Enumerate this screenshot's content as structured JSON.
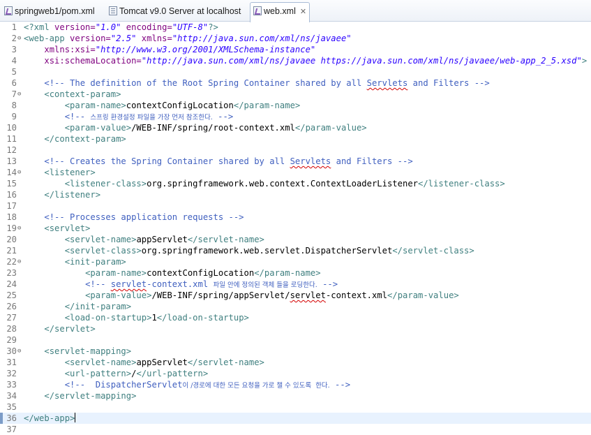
{
  "tabs": [
    {
      "label": "springweb1/pom.xml",
      "icon": "xml-file-icon",
      "active": false
    },
    {
      "label": "Tomcat v9.0 Server at localhost",
      "icon": "page-icon",
      "active": false
    },
    {
      "label": "web.xml",
      "icon": "xml-file-icon",
      "active": true,
      "close": "✕"
    }
  ],
  "editor": {
    "current_line": 36,
    "lines": [
      {
        "n": "1",
        "fold": false,
        "indent": 0,
        "parts": [
          [
            "pi",
            "<?xml "
          ],
          [
            "attr",
            "version="
          ],
          [
            "val",
            "\"1.0\""
          ],
          [
            "pi",
            " "
          ],
          [
            "attr",
            "encoding="
          ],
          [
            "val",
            "\"UTF-8\""
          ],
          [
            "pi",
            "?>"
          ]
        ]
      },
      {
        "n": "2",
        "fold": true,
        "indent": 0,
        "parts": [
          [
            "tag",
            "<web-app "
          ],
          [
            "attr",
            "version="
          ],
          [
            "val",
            "\"2.5\""
          ],
          [
            "tag",
            " "
          ],
          [
            "attr",
            "xmlns="
          ],
          [
            "val",
            "\"http://java.sun.com/xml/ns/javaee\""
          ]
        ]
      },
      {
        "n": "3",
        "fold": false,
        "indent": 4,
        "parts": [
          [
            "attr",
            "xmlns:xsi="
          ],
          [
            "val",
            "\"http://www.w3.org/2001/XMLSchema-instance\""
          ]
        ]
      },
      {
        "n": "4",
        "fold": false,
        "indent": 4,
        "parts": [
          [
            "attr",
            "xsi:schemaLocation="
          ],
          [
            "val",
            "\"http://java.sun.com/xml/ns/javaee https://java.sun.com/xml/ns/javaee/web-app_2_5.xsd\""
          ],
          [
            "tag",
            ">"
          ]
        ]
      },
      {
        "n": "5",
        "fold": false,
        "indent": 0,
        "parts": []
      },
      {
        "n": "6",
        "fold": false,
        "indent": 4,
        "parts": [
          [
            "com",
            "<!-- The definition of the Root Spring Container shared by all "
          ],
          [
            "comsq",
            "Servlets"
          ],
          [
            "com",
            " and Filters -->"
          ]
        ]
      },
      {
        "n": "7",
        "fold": true,
        "indent": 4,
        "parts": [
          [
            "tag",
            "<context-param>"
          ]
        ]
      },
      {
        "n": "8",
        "fold": false,
        "indent": 8,
        "parts": [
          [
            "tag",
            "<param-name>"
          ],
          [
            "text",
            "contextConfigLocation"
          ],
          [
            "tag",
            "</param-name>"
          ]
        ]
      },
      {
        "n": "9",
        "fold": false,
        "indent": 8,
        "parts": [
          [
            "com",
            "<!-- "
          ],
          [
            "comko",
            "스프링 환경설정 파일을 가장 먼저 참조한다."
          ],
          [
            "com",
            " -->"
          ]
        ]
      },
      {
        "n": "10",
        "fold": false,
        "indent": 8,
        "parts": [
          [
            "tag",
            "<param-value>"
          ],
          [
            "text",
            "/WEB-INF/spring/root-context.xml"
          ],
          [
            "tag",
            "</param-value>"
          ]
        ]
      },
      {
        "n": "11",
        "fold": false,
        "indent": 4,
        "parts": [
          [
            "tag",
            "</context-param>"
          ]
        ]
      },
      {
        "n": "12",
        "fold": false,
        "indent": 0,
        "parts": []
      },
      {
        "n": "13",
        "fold": false,
        "indent": 4,
        "parts": [
          [
            "com",
            "<!-- Creates the Spring Container shared by all "
          ],
          [
            "comsq",
            "Servlets"
          ],
          [
            "com",
            " and Filters -->"
          ]
        ]
      },
      {
        "n": "14",
        "fold": true,
        "indent": 4,
        "parts": [
          [
            "tag",
            "<listener>"
          ]
        ]
      },
      {
        "n": "15",
        "fold": false,
        "indent": 8,
        "parts": [
          [
            "tag",
            "<listener-class>"
          ],
          [
            "text",
            "org.springframework.web.context.ContextLoaderListener"
          ],
          [
            "tag",
            "</listener-class>"
          ]
        ]
      },
      {
        "n": "16",
        "fold": false,
        "indent": 4,
        "parts": [
          [
            "tag",
            "</listener>"
          ]
        ]
      },
      {
        "n": "17",
        "fold": false,
        "indent": 0,
        "parts": []
      },
      {
        "n": "18",
        "fold": false,
        "indent": 4,
        "parts": [
          [
            "com",
            "<!-- Processes application requests -->"
          ]
        ]
      },
      {
        "n": "19",
        "fold": true,
        "indent": 4,
        "parts": [
          [
            "tag",
            "<servlet>"
          ]
        ]
      },
      {
        "n": "20",
        "fold": false,
        "indent": 8,
        "parts": [
          [
            "tag",
            "<servlet-name>"
          ],
          [
            "text",
            "appServlet"
          ],
          [
            "tag",
            "</servlet-name>"
          ]
        ]
      },
      {
        "n": "21",
        "fold": false,
        "indent": 8,
        "parts": [
          [
            "tag",
            "<servlet-class>"
          ],
          [
            "text",
            "org.springframework.web.servlet.DispatcherServlet"
          ],
          [
            "tag",
            "</servlet-class>"
          ]
        ]
      },
      {
        "n": "22",
        "fold": true,
        "indent": 8,
        "parts": [
          [
            "tag",
            "<init-param>"
          ]
        ]
      },
      {
        "n": "23",
        "fold": false,
        "indent": 12,
        "parts": [
          [
            "tag",
            "<param-name>"
          ],
          [
            "text",
            "contextConfigLocation"
          ],
          [
            "tag",
            "</param-name>"
          ]
        ]
      },
      {
        "n": "24",
        "fold": false,
        "indent": 12,
        "parts": [
          [
            "com",
            "<!-- "
          ],
          [
            "comsq",
            "servlet"
          ],
          [
            "com",
            "-context.xml "
          ],
          [
            "comko",
            "파일 안에 정의된 객체 들을 로딩한다."
          ],
          [
            "com",
            " -->"
          ]
        ]
      },
      {
        "n": "25",
        "fold": false,
        "indent": 12,
        "parts": [
          [
            "tag",
            "<param-value>"
          ],
          [
            "text",
            "/WEB-INF/spring/appServlet/"
          ],
          [
            "textsq",
            "servlet"
          ],
          [
            "text",
            "-context.xml"
          ],
          [
            "tag",
            "</param-value>"
          ]
        ]
      },
      {
        "n": "26",
        "fold": false,
        "indent": 8,
        "parts": [
          [
            "tag",
            "</init-param>"
          ]
        ]
      },
      {
        "n": "27",
        "fold": false,
        "indent": 8,
        "parts": [
          [
            "tag",
            "<load-on-startup>"
          ],
          [
            "text",
            "1"
          ],
          [
            "tag",
            "</load-on-startup>"
          ]
        ]
      },
      {
        "n": "28",
        "fold": false,
        "indent": 4,
        "parts": [
          [
            "tag",
            "</servlet>"
          ]
        ]
      },
      {
        "n": "29",
        "fold": false,
        "indent": 0,
        "parts": []
      },
      {
        "n": "30",
        "fold": true,
        "indent": 4,
        "parts": [
          [
            "tag",
            "<servlet-mapping>"
          ]
        ]
      },
      {
        "n": "31",
        "fold": false,
        "indent": 8,
        "parts": [
          [
            "tag",
            "<servlet-name>"
          ],
          [
            "text",
            "appServlet"
          ],
          [
            "tag",
            "</servlet-name>"
          ]
        ]
      },
      {
        "n": "32",
        "fold": false,
        "indent": 8,
        "parts": [
          [
            "tag",
            "<url-pattern>"
          ],
          [
            "text",
            "/"
          ],
          [
            "tag",
            "</url-pattern>"
          ]
        ]
      },
      {
        "n": "33",
        "fold": false,
        "indent": 8,
        "parts": [
          [
            "com",
            "<!--  DispatcherServlet"
          ],
          [
            "comko",
            "이 /경로에 대한 모든 요청을 가로 챌 수 있도록  한다."
          ],
          [
            "com",
            " -->"
          ]
        ]
      },
      {
        "n": "34",
        "fold": false,
        "indent": 4,
        "parts": [
          [
            "tag",
            "</servlet-mapping>"
          ]
        ]
      },
      {
        "n": "35",
        "fold": false,
        "indent": 0,
        "parts": []
      },
      {
        "n": "36",
        "fold": false,
        "indent": 0,
        "parts": [
          [
            "tag",
            "</web-app>"
          ]
        ]
      },
      {
        "n": "37",
        "fold": false,
        "indent": 0,
        "parts": []
      }
    ]
  },
  "colors": {
    "tag": "#3f7f7f",
    "attribute": "#7f007f",
    "value": "#2a00ff",
    "comment": "#3f5fbf",
    "current_line": "#e8f2fe"
  }
}
